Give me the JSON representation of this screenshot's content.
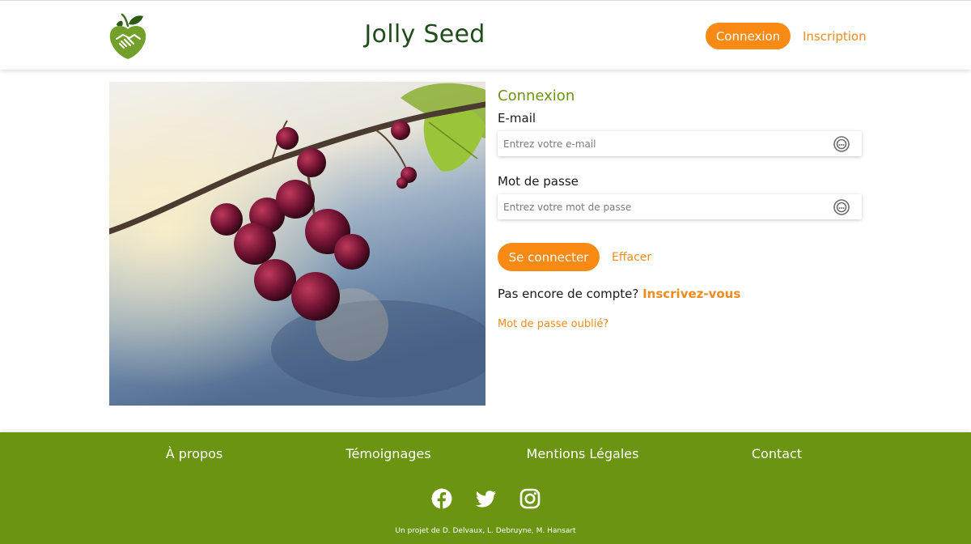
{
  "header": {
    "brand": "Jolly Seed",
    "login_button": "Connexion",
    "register_link": "Inscription"
  },
  "login_form": {
    "title": "Connexion",
    "email_label": "E-mail",
    "email_placeholder": "Entrez votre e-mail",
    "email_value": "",
    "password_label": "Mot de passe",
    "password_placeholder": "Entrez votre mot de passe",
    "password_value": "",
    "submit_button": "Se connecter",
    "clear_link": "Effacer",
    "no_account_text": "Pas encore de compte?",
    "signup_link": "Inscrivez-vous",
    "forgot_password_link": "Mot de passe oublié?"
  },
  "footer": {
    "nav": [
      "À propos",
      "Témoignages",
      "Mentions Légales",
      "Contact"
    ],
    "social_icons": [
      "facebook-icon",
      "twitter-icon",
      "instagram-icon"
    ],
    "credit": "Un projet de D. Delvaux, L. Debruyne, M. Hansart"
  },
  "colors": {
    "accent_orange": "#fb8a14",
    "brand_green": "#6b9410",
    "brand_dark_green": "#1f4e1a"
  }
}
